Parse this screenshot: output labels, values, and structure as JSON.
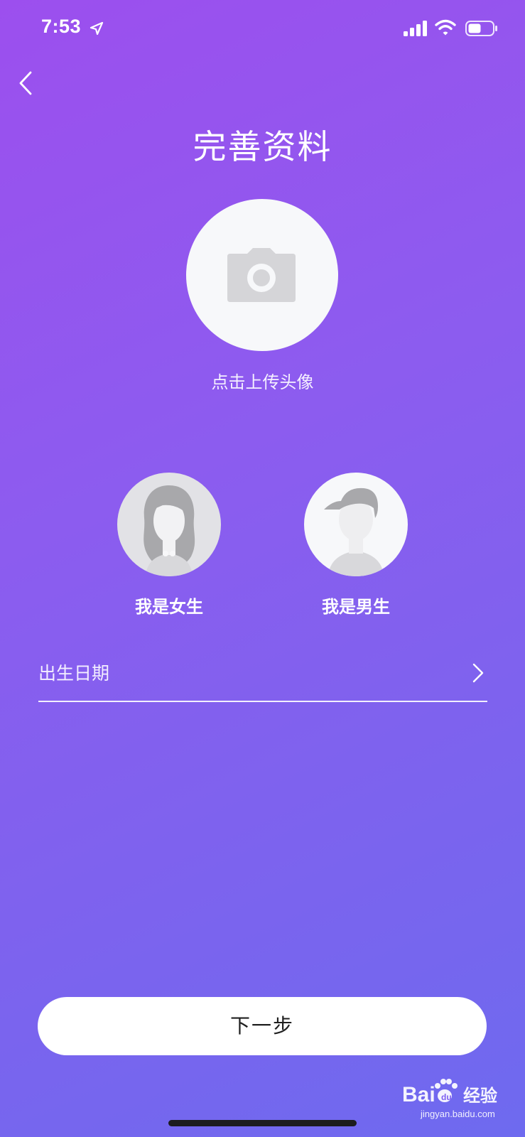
{
  "status_bar": {
    "time": "7:53"
  },
  "header": {
    "title": "完善资料"
  },
  "avatar": {
    "upload_label": "点击上传头像"
  },
  "gender": {
    "female_label": "我是女生",
    "male_label": "我是男生"
  },
  "birth_date": {
    "label": "出生日期"
  },
  "footer": {
    "next_label": "下一步"
  },
  "watermark": {
    "brand": "Baidu经验",
    "url": "jingyan.baidu.com"
  },
  "colors": {
    "gradient_start": "#9c4fee",
    "gradient_end": "#6e6aef",
    "button_bg": "#ffffff",
    "avatar_bg": "#f7f8fa",
    "placeholder_gray": "#d5d5d8"
  },
  "icons": [
    "location-arrow-icon",
    "signal-icon",
    "wifi-icon",
    "battery-icon",
    "back-icon",
    "camera-icon",
    "female-avatar-icon",
    "male-avatar-icon",
    "chevron-right-icon"
  ]
}
